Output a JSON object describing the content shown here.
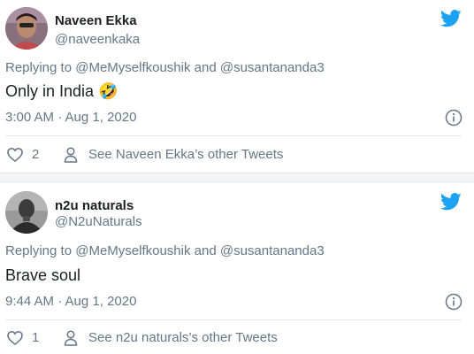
{
  "tweets": [
    {
      "author_name": "Naveen Ekka",
      "author_handle": "@naveenkaka",
      "replying_prefix": "Replying to",
      "mention1": "@MeMyselfkoushik",
      "and_word": "and",
      "mention2": "@susantananda3",
      "text": "Only in India",
      "emoji": "🤣",
      "timestamp": "3:00 AM · Aug 1, 2020",
      "likes": "2",
      "other_tweets": "See Naveen Ekka’s other Tweets"
    },
    {
      "author_name": "n2u naturals",
      "author_handle": "@N2uNaturals",
      "replying_prefix": "Replying to",
      "mention1": "@MeMyselfkoushik",
      "and_word": "and",
      "mention2": "@susantananda3",
      "text": "Brave soul",
      "emoji": "",
      "timestamp": "9:44 AM · Aug 1, 2020",
      "likes": "1",
      "other_tweets": "See n2u naturals’s other Tweets"
    }
  ],
  "colors": {
    "twitter_blue": "#1da1f2",
    "secondary_text": "#657786",
    "primary_text": "#1c2022"
  },
  "icons": [
    "twitter-bird-icon",
    "info-icon",
    "heart-icon",
    "person-icon",
    "avatar"
  ]
}
